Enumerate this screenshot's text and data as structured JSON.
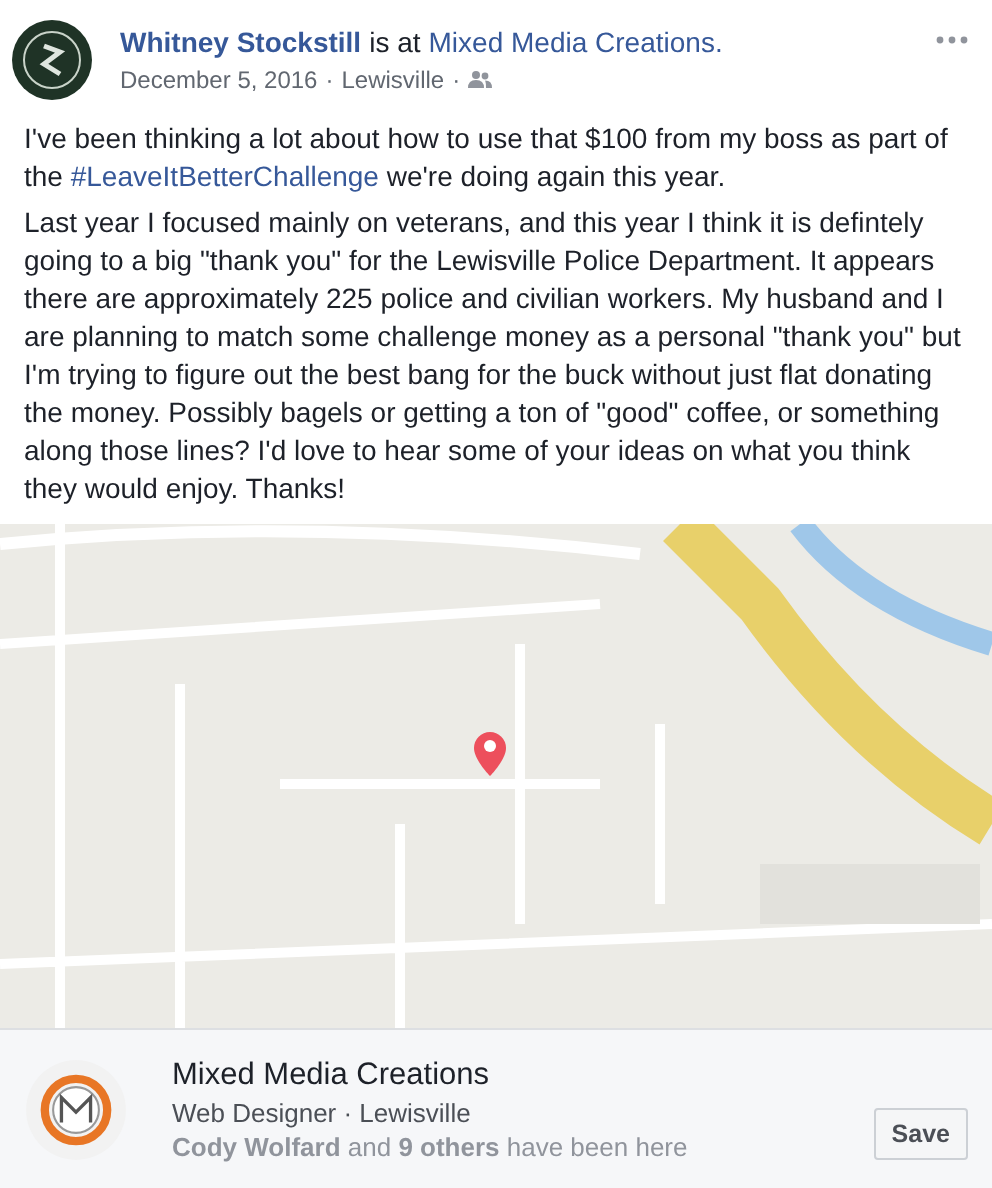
{
  "post": {
    "author": "Whitney Stockstill",
    "connector": "is at",
    "place": "Mixed Media Creations.",
    "date": "December 5, 2016",
    "location": "Lewisville",
    "separator": "·",
    "paragraphs": [
      {
        "before": "I've been thinking a lot about how to use that $100 from my boss as part of the ",
        "hashtag": "#LeaveItBetterChallenge",
        "after": " we're doing again this year."
      },
      {
        "before": "Last year I focused mainly on veterans, and this year I think it is defintely going to a big \"thank you\" for the Lewisville Police Department. It appears there are approximately 225 police and civilian workers. My husband and I are planning to match some challenge money as a personal \"thank you\" but I'm trying to figure out the best bang for the buck without just flat donating the money. Possibly bagels or getting a ton of \"good\" coffee, or something along those lines? I'd love to hear some of your ideas on what you think they would enjoy. Thanks!"
      }
    ]
  },
  "place_card": {
    "name": "Mixed Media Creations",
    "details": "Web Designer · Lewisville",
    "visitors": "**Cody Wolfard** and **9 others** have been here",
    "save": "Save"
  }
}
